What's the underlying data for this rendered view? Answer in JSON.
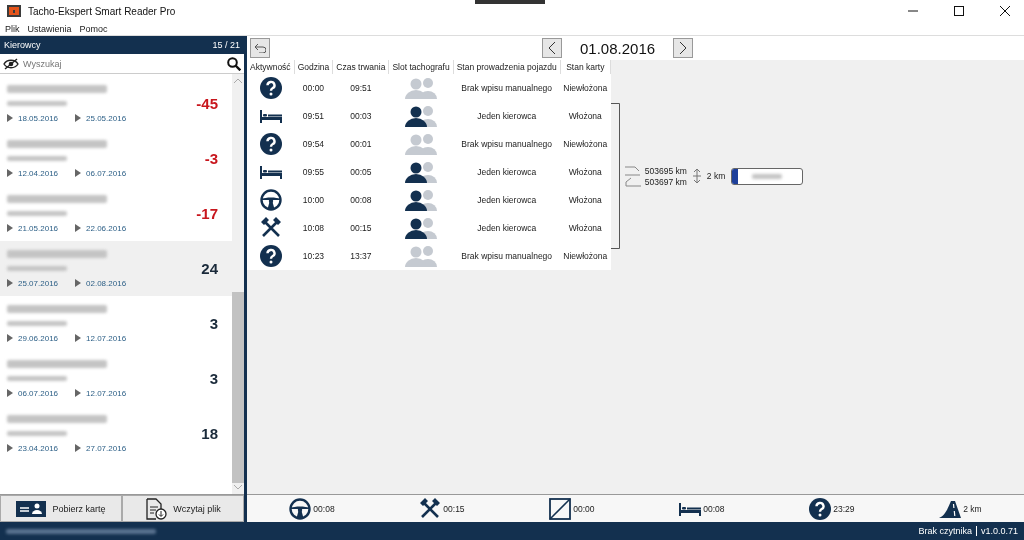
{
  "window": {
    "title": "Tacho-Ekspert Smart Reader Pro"
  },
  "menu": [
    "Plik",
    "Ustawienia",
    "Pomoc"
  ],
  "drivers_panel": {
    "title": "Kierowcy",
    "count": "15 / 21",
    "search": {
      "placeholder": "Wyszukaj"
    },
    "drivers": [
      {
        "value": "-45",
        "negative": true,
        "start": "18.05.2016",
        "end": "25.05.2016",
        "selected": false
      },
      {
        "value": "-3",
        "negative": true,
        "start": "12.04.2016",
        "end": "06.07.2016",
        "selected": false
      },
      {
        "value": "-17",
        "negative": true,
        "start": "21.05.2016",
        "end": "22.06.2016",
        "selected": false
      },
      {
        "value": "24",
        "negative": false,
        "start": "25.07.2016",
        "end": "02.08.2016",
        "selected": true
      },
      {
        "value": "3",
        "negative": false,
        "start": "29.06.2016",
        "end": "12.07.2016",
        "selected": false
      },
      {
        "value": "3",
        "negative": false,
        "start": "06.07.2016",
        "end": "12.07.2016",
        "selected": false
      },
      {
        "value": "18",
        "negative": false,
        "start": "23.04.2016",
        "end": "27.07.2016",
        "selected": false
      }
    ]
  },
  "actions": [
    {
      "kind": "card",
      "label": "Pobierz kartę"
    },
    {
      "kind": "file",
      "label": "Wczytaj plik"
    }
  ],
  "date": "01.08.2016",
  "table": {
    "columns": [
      "Aktywność",
      "Godzina",
      "Czas trwania",
      "Slot tachografu",
      "Stan prowadzenia pojazdu",
      "Stan karty"
    ],
    "rows": [
      {
        "kind": "unknown",
        "time": "00:00",
        "duration": "09:51",
        "card_inserted": false,
        "mode": "Brak wpisu manualnego",
        "card_state": "Niewłożona"
      },
      {
        "kind": "rest",
        "time": "09:51",
        "duration": "00:03",
        "card_inserted": true,
        "mode": "Jeden kierowca",
        "card_state": "Włożona"
      },
      {
        "kind": "unknown",
        "time": "09:54",
        "duration": "00:01",
        "card_inserted": false,
        "mode": "Brak wpisu manualnego",
        "card_state": "Niewłożona"
      },
      {
        "kind": "rest",
        "time": "09:55",
        "duration": "00:05",
        "card_inserted": true,
        "mode": "Jeden kierowca",
        "card_state": "Włożona"
      },
      {
        "kind": "driving",
        "time": "10:00",
        "duration": "00:08",
        "card_inserted": true,
        "mode": "Jeden kierowca",
        "card_state": "Włożona"
      },
      {
        "kind": "work",
        "time": "10:08",
        "duration": "00:15",
        "card_inserted": true,
        "mode": "Jeden kierowca",
        "card_state": "Włożona"
      },
      {
        "kind": "unknown",
        "time": "10:23",
        "duration": "13:37",
        "card_inserted": false,
        "mode": "Brak wpisu manualnego",
        "card_state": "Niewłożona"
      }
    ]
  },
  "odometer": {
    "start": "503695 km",
    "end": "503697 km",
    "distance": "2 km"
  },
  "summary": [
    {
      "kind": "driving",
      "value": "00:08"
    },
    {
      "kind": "work",
      "value": "00:15"
    },
    {
      "kind": "available",
      "value": "00:00"
    },
    {
      "kind": "rest",
      "value": "00:08"
    },
    {
      "kind": "unknown",
      "value": "23:29"
    },
    {
      "kind": "distance",
      "value": "2 km"
    }
  ],
  "status_bar": {
    "reader": "Brak czytnika",
    "version": "v1.0.0.71"
  }
}
